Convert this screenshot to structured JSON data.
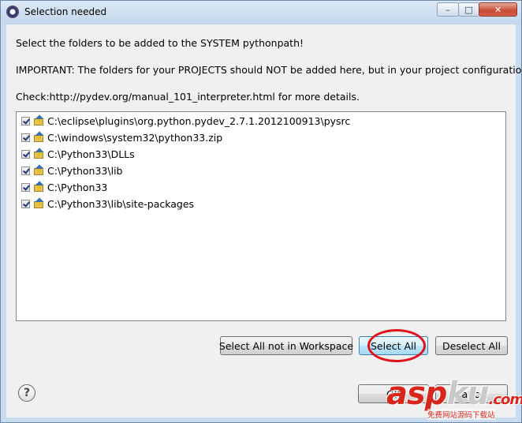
{
  "window": {
    "title": "Selection needed"
  },
  "title_buttons": {
    "minimize": "–",
    "maximize": "□",
    "close": "✕"
  },
  "messages": {
    "line1": "Select the folders to be added to the SYSTEM pythonpath!",
    "line2": "IMPORTANT: The folders for your PROJECTS should NOT be added here, but in your project configuration.",
    "line3": "Check:http://pydev.org/manual_101_interpreter.html for more details."
  },
  "folders": [
    {
      "path": "C:\\eclipse\\plugins\\org.python.pydev_2.7.1.2012100913\\pysrc",
      "checked": true
    },
    {
      "path": "C:\\windows\\system32\\python33.zip",
      "checked": true
    },
    {
      "path": "C:\\Python33\\DLLs",
      "checked": true
    },
    {
      "path": "C:\\Python33\\lib",
      "checked": true
    },
    {
      "path": "C:\\Python33",
      "checked": true
    },
    {
      "path": "C:\\Python33\\lib\\site-packages",
      "checked": true
    }
  ],
  "buttons": {
    "select_all_not_in_workspace": "Select All not in Workspace",
    "select_all": "Select All",
    "deselect_all": "Deselect All",
    "ok": "OK",
    "cancel": "Cancel"
  },
  "help_icon": "?",
  "watermark": {
    "main": "asp",
    "ku": "ku",
    "suffix": ".com",
    "sub": "免费网站源码下载站"
  }
}
